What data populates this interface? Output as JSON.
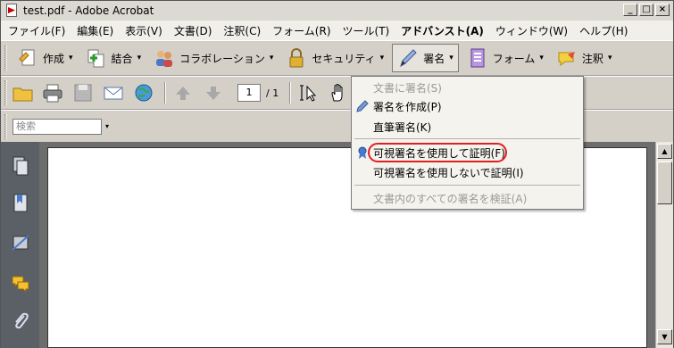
{
  "window": {
    "title": "test.pdf - Adobe Acrobat",
    "controls": {
      "minimize": "_",
      "maximize": "□",
      "close": "×"
    }
  },
  "menubar": {
    "items": [
      {
        "label": "ファイル(F)",
        "bold": false
      },
      {
        "label": "編集(E)",
        "bold": false
      },
      {
        "label": "表示(V)",
        "bold": false
      },
      {
        "label": "文書(D)",
        "bold": false
      },
      {
        "label": "注釈(C)",
        "bold": false
      },
      {
        "label": "フォーム(R)",
        "bold": false
      },
      {
        "label": "ツール(T)",
        "bold": false
      },
      {
        "label": "アドバンスト(A)",
        "bold": true
      },
      {
        "label": "ウィンドウ(W)",
        "bold": false
      },
      {
        "label": "ヘルプ(H)",
        "bold": false
      }
    ]
  },
  "task_toolbar": {
    "create": "作成",
    "combine": "結合",
    "collaboration": "コラボレーション",
    "security": "セキュリティ",
    "sign": "署名",
    "forms": "フォーム",
    "comment": "注釈"
  },
  "nav_toolbar": {
    "current_page": "1",
    "total_pages": "/ 1"
  },
  "search": {
    "placeholder": "検索"
  },
  "sign_menu": {
    "items": [
      {
        "label": "文書に署名(S)",
        "disabled": true
      },
      {
        "label": "署名を作成(P)",
        "disabled": false
      },
      {
        "label": "直筆署名(K)",
        "disabled": false
      },
      {
        "label": "可視署名を使用して証明(F)",
        "disabled": false,
        "highlighted": true
      },
      {
        "label": "可視署名を使用しないで証明(I)",
        "disabled": false
      },
      {
        "label": "文書内のすべての署名を検証(A)",
        "disabled": true
      }
    ]
  },
  "colors": {
    "highlight_ring": "#e02020",
    "nav_panel": "#5b5f66",
    "doc_background": "#6d6d6d"
  }
}
